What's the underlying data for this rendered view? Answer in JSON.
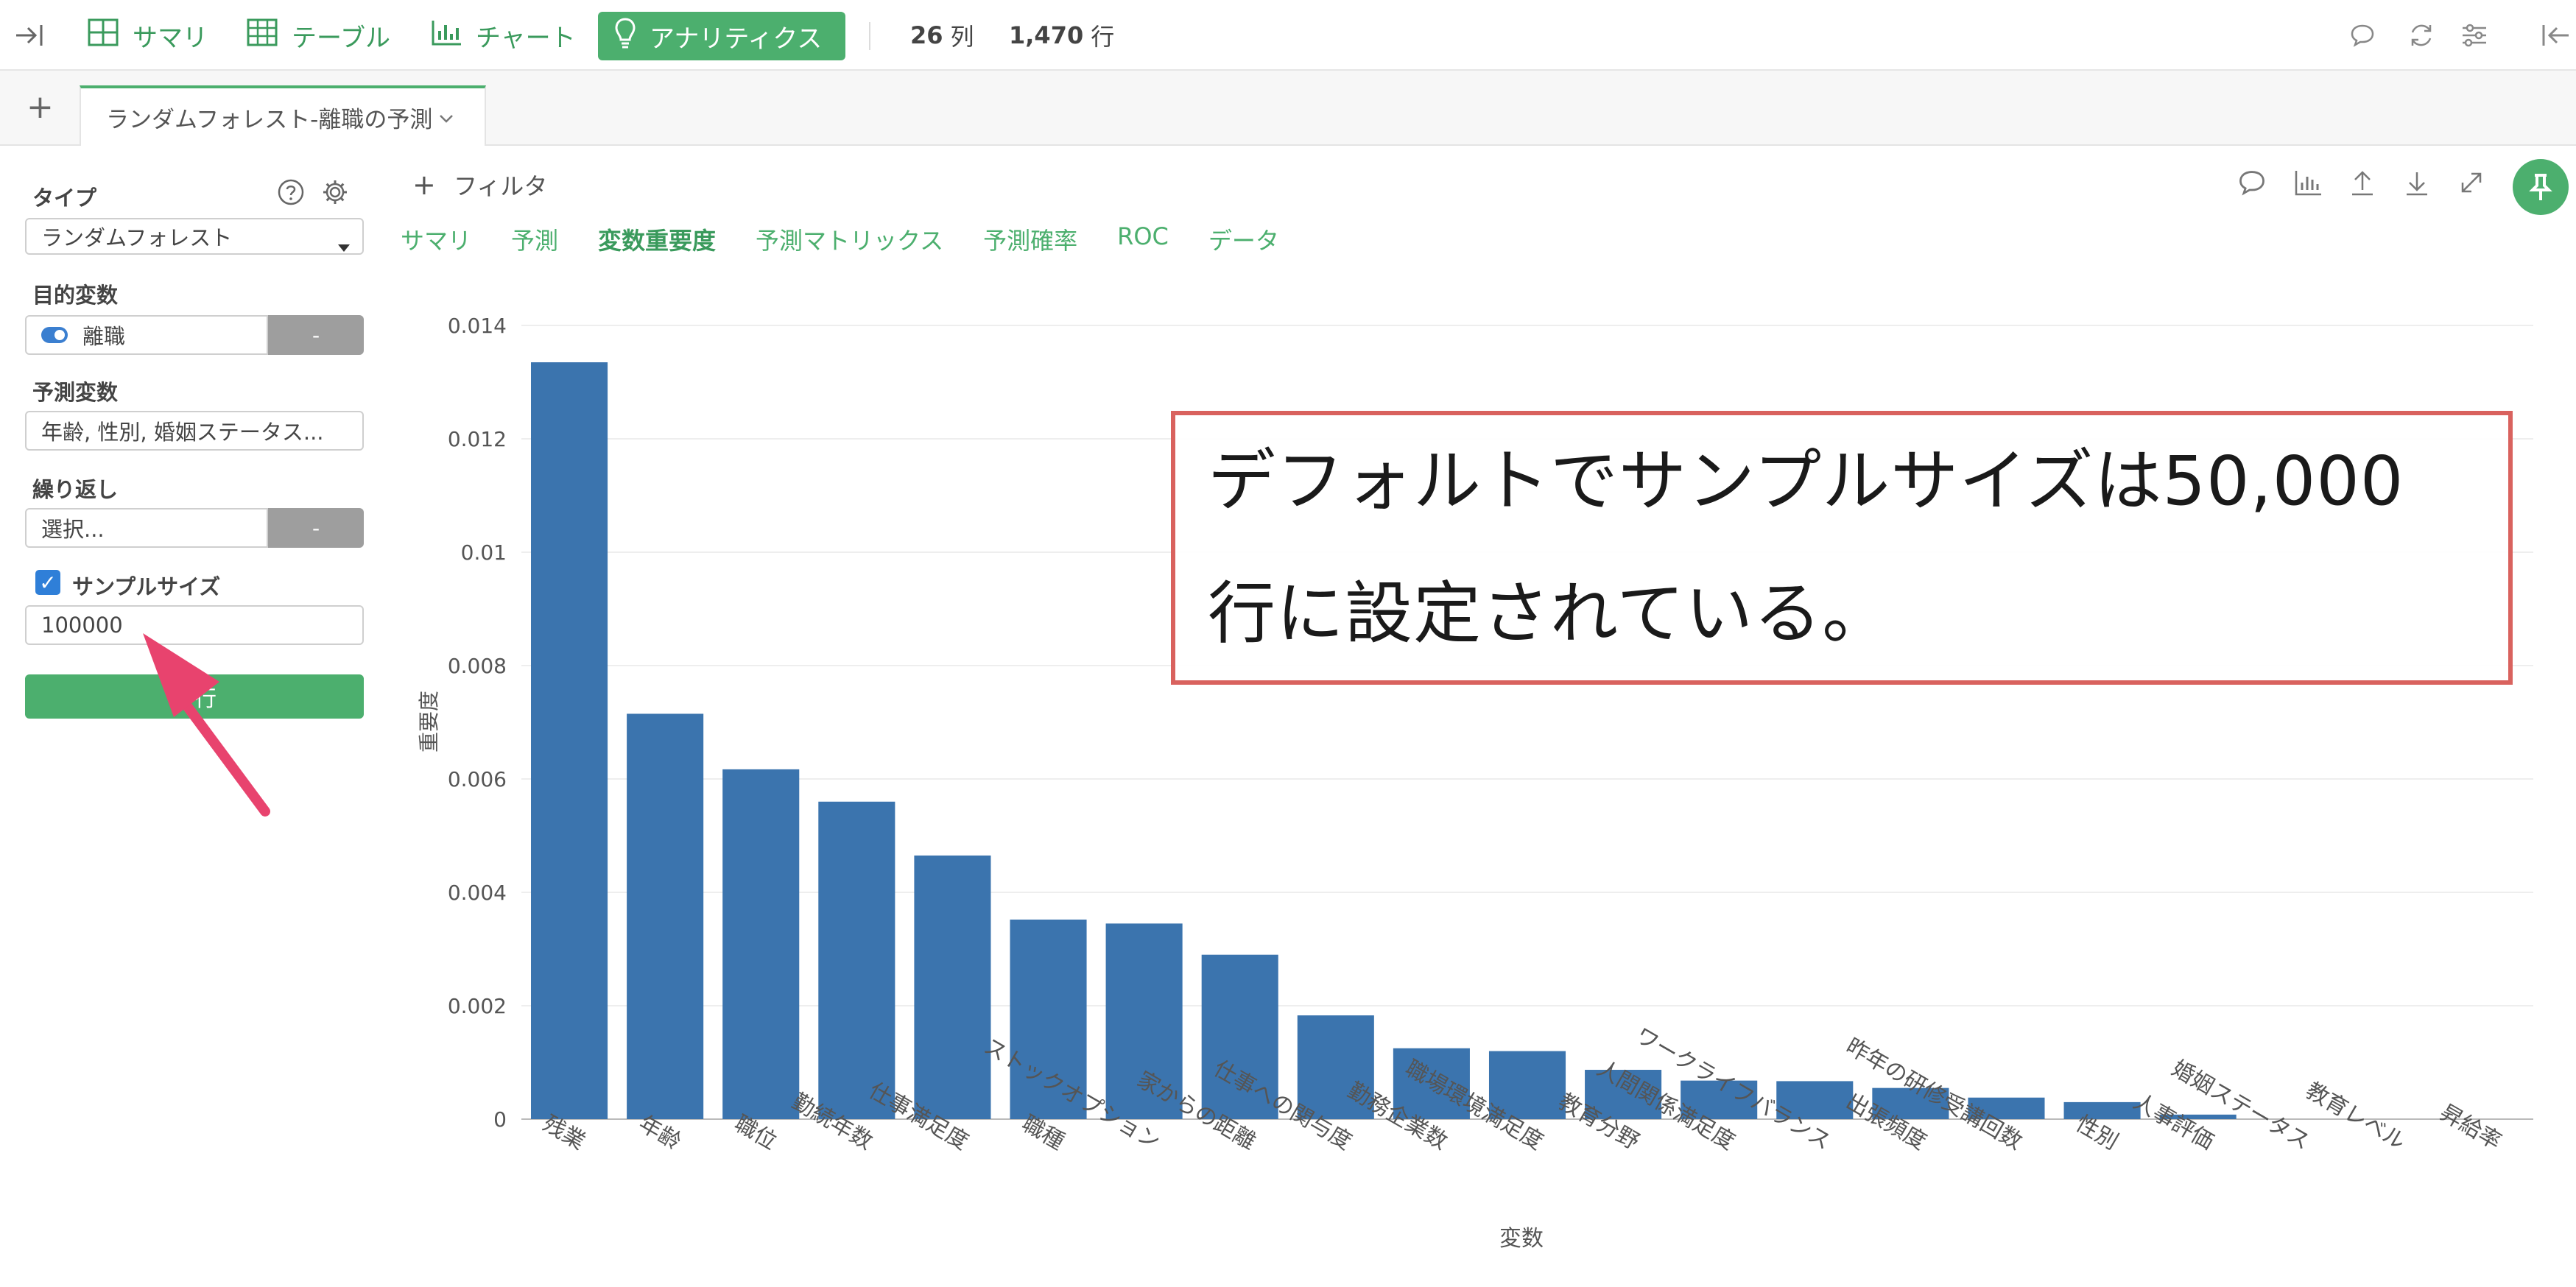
{
  "topbar": {
    "summary_label": "サマリ",
    "table_label": "テーブル",
    "chart_label": "チャート",
    "analytics_label": "アナリティクス",
    "columns_count": "26",
    "columns_unit": "列",
    "rows_count": "1,470",
    "rows_unit": "行"
  },
  "tab": {
    "add_label": "+",
    "active_label": "ランダムフォレスト-離職の予測"
  },
  "sidebar": {
    "type_label": "タイプ",
    "type_value": "ランダムフォレスト",
    "target_label": "目的変数",
    "target_value": "離職",
    "target_btn": "-",
    "predictor_label": "予測変数",
    "predictor_value": "年齢, 性別, 婚姻ステータス...",
    "repeat_label": "繰り返し",
    "repeat_value": "選択...",
    "repeat_btn": "-",
    "sample_label": "サンプルサイズ",
    "sample_value": "100000",
    "run_label": "実行"
  },
  "content": {
    "filter_label": "フィルタ",
    "subtabs": [
      "サマリ",
      "予測",
      "変数重要度",
      "予測マトリックス",
      "予測確率",
      "ROC",
      "データ"
    ],
    "active_subtab": "変数重要度"
  },
  "annotation": {
    "line1": "デフォルトでサンプルサイズは50,000",
    "line2": "行に設定されている。"
  },
  "colors": {
    "accent": "#4caf6e",
    "bar": "#3b74ae",
    "annotation_border": "#d9625e",
    "arrow": "#e8436e"
  },
  "chart_data": {
    "type": "bar",
    "xlabel": "変数",
    "ylabel": "重要度",
    "ylim": [
      0,
      0.014
    ],
    "yticks": [
      "0",
      "0.002",
      "0.004",
      "0.006",
      "0.008",
      "0.01",
      "0.012",
      "0.014"
    ],
    "grid": true,
    "categories": [
      "残業",
      "年齢",
      "職位",
      "勤続年数",
      "仕事満足度",
      "職種",
      "ストックオプション",
      "家からの距離",
      "仕事への関与度",
      "勤務企業数",
      "職場環境満足度",
      "教育分野",
      "人間関係満足度",
      "ワークライフバランス",
      "出張頻度",
      "昨年の研修受講回数",
      "性別",
      "人事評価",
      "婚姻ステータス",
      "教育レベル",
      "昇給率"
    ],
    "values": [
      0.01335,
      0.00715,
      0.00617,
      0.0056,
      0.00465,
      0.00352,
      0.00345,
      0.0029,
      0.00183,
      0.00125,
      0.0012,
      0.00087,
      0.00068,
      0.00067,
      0.00055,
      0.00038,
      0.0003,
      8e-05,
      0,
      0,
      0
    ]
  }
}
